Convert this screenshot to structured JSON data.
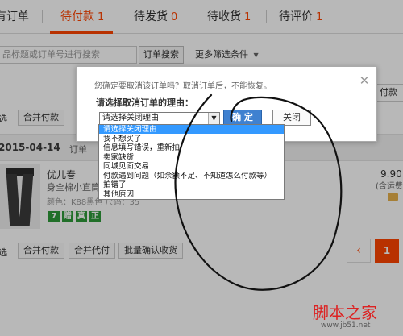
{
  "tabs": [
    {
      "label": "有订单",
      "count": ""
    },
    {
      "label": "待付款",
      "count": "1"
    },
    {
      "label": "待发货",
      "count": "0"
    },
    {
      "label": "待收货",
      "count": "1"
    },
    {
      "label": "待评价",
      "count": "1"
    }
  ],
  "search": {
    "placeholder": "品标题或订单号进行搜索",
    "button": "订单搜索",
    "more_filters": "更多筛选条件"
  },
  "toolbar": {
    "select_all": "选",
    "merge_pay": "合并付款",
    "right_cell": "付款"
  },
  "order": {
    "date": "2015-04-14",
    "order_no_label": "订单",
    "product_title": "优儿春",
    "product_subtitle": "身全棉小直筒",
    "product_spec": "颜色：K88黑色 尺码：35",
    "badges": [
      "7",
      "赠",
      "真",
      "正"
    ],
    "price": "9.90",
    "shipping": "(含运费：",
    "colors": {
      "accent": "#ff4400",
      "badge_green": "#2e9a3a"
    }
  },
  "bottom_bar": {
    "select_all": "选",
    "merge_pay": "合并付款",
    "merge_agent_pay": "合并代付",
    "batch_confirm": "批量确认收货"
  },
  "pager": {
    "prev": "‹",
    "current": "1"
  },
  "dialog": {
    "notice": "您确定要取消该订单吗？取消订单后，不能恢复。",
    "reason_label": "请选择取消订单的理由：",
    "selected_reason": "请选择关闭理由",
    "confirm_button": "确 定",
    "cancel_button": "关闭",
    "reasons": [
      "请选择关闭理由",
      "我不想买了",
      "信息填写错误，重新拍",
      "卖家缺货",
      "同城见面交易",
      "付款遇到问题（如余额不足、不知道怎么付款等）",
      "拍错了",
      "其他原因"
    ]
  },
  "watermark": {
    "title": "脚本之家",
    "url": "www.jb51.net"
  }
}
